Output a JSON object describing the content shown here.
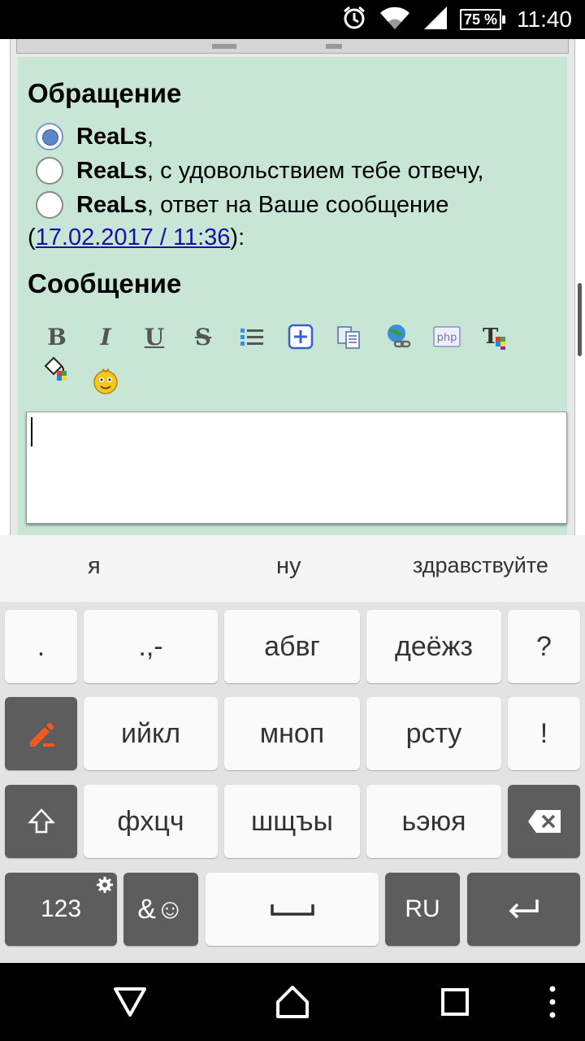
{
  "status_bar": {
    "time": "11:40",
    "battery": "75 %",
    "icons": [
      "alarm-icon",
      "wifi-icon",
      "signal-icon",
      "battery-icon"
    ]
  },
  "form": {
    "address_heading": "Обращение",
    "radio_options": [
      {
        "nick": "ReaLs",
        "suffix": ",",
        "checked": true
      },
      {
        "nick": "ReaLs",
        "suffix": ", с удовольствием тебе отвечу,",
        "checked": false
      },
      {
        "nick": "ReaLs",
        "suffix": ", ответ на Ваше сообщение",
        "checked": false
      }
    ],
    "date_open": "(",
    "date_link": "17.02.2017 / 11:36",
    "date_close": "):",
    "message_heading": "Сообщение",
    "toolbar": {
      "bold": "B",
      "italic": "I",
      "underline": "U",
      "strike": "S"
    },
    "message_text": ""
  },
  "keyboard": {
    "suggestions": [
      "я",
      "ну",
      "здравствуйте"
    ],
    "row1": [
      ".",
      ".,-",
      "абвг",
      "деёжз",
      "?"
    ],
    "row2": [
      "ийкл",
      "мноп",
      "рсту",
      "!"
    ],
    "row3": [
      "фхцч",
      "шщъы",
      "ьэюя"
    ],
    "row4": {
      "numbers": "123",
      "symbols": "&☺",
      "language": "RU"
    }
  },
  "colors": {
    "form_bg": "#c8e6d5",
    "link": "#1a0dab",
    "edit_accent": "#f05a22"
  }
}
